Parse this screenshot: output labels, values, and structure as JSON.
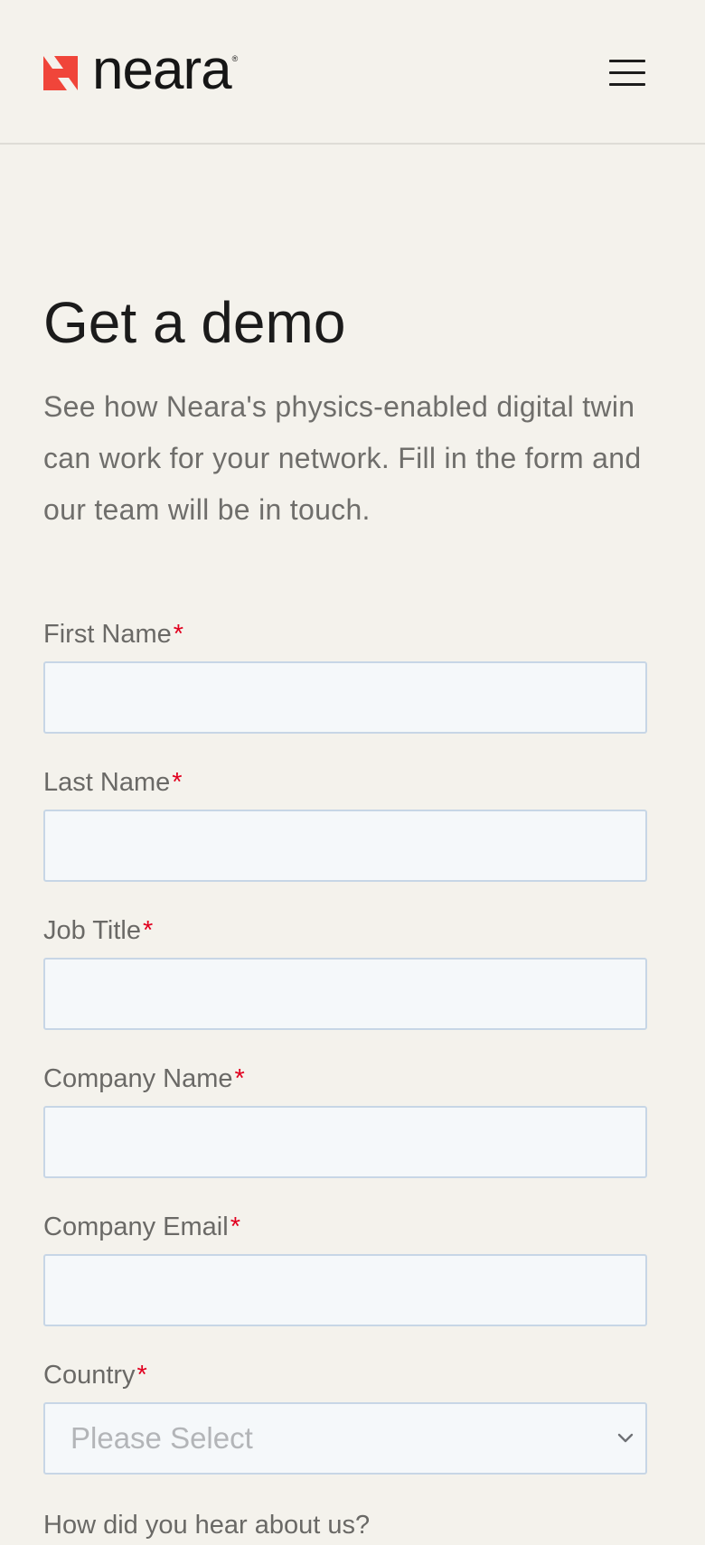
{
  "brand": {
    "name": "neara",
    "registered": "®",
    "mark_color": "#f0453a"
  },
  "header": {
    "menu_icon": "hamburger-menu-icon"
  },
  "main": {
    "title": "Get a demo",
    "intro": "See how Neara's physics-enabled digital twin can work for your network. Fill in the form and our team will be in touch."
  },
  "form": {
    "required_marker": "*",
    "required_color": "#e1001f",
    "fields": {
      "first_name": {
        "label": "First Name",
        "value": ""
      },
      "last_name": {
        "label": "Last Name",
        "value": ""
      },
      "job_title": {
        "label": "Job Title",
        "value": ""
      },
      "company_name": {
        "label": "Company Name",
        "value": ""
      },
      "company_email": {
        "label": "Company Email",
        "value": ""
      },
      "country": {
        "label": "Country",
        "value": "Please Select"
      }
    },
    "next_question": "How did you hear about us?"
  }
}
